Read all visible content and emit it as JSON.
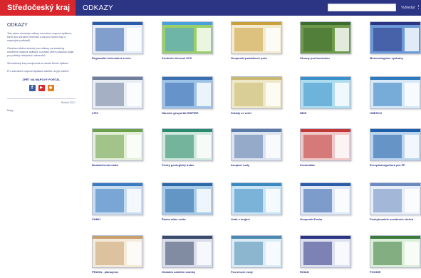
{
  "header": {
    "brand": "Středočeský kraj",
    "section": "ODKAZY",
    "search_placeholder": "",
    "search_button": "Vyhledat"
  },
  "sidebar": {
    "title": "ODKAZY",
    "intro": "Tato sekce obsahuje odkazy na externí mapové aplikace, které jsou zdrojem informací a dat pro tvorbu map a mapových podkladů.",
    "text2": "Obsahem těchto stránek jsou odkazy na tematicky zaměřené mapové aplikace a portály, které poskytují údaje pro potřeby veřejnosti i odborníků.",
    "text3": "Středočeský kraj neodpovídá za obsah těchto aplikací.",
    "text4": "Pro zobrazení mapové aplikace klikněte na její náhled.",
    "link": "ZPĚT NA MAPOVÝ PORTÁL",
    "date": "Ročník 2017",
    "footer": "Mapy"
  },
  "cards": [
    {
      "label": "Regionální informační servis",
      "theme": "#2b5ca8",
      "accent": "#e8eef8"
    },
    {
      "label": "Kontrolní činnost SVS",
      "theme": "#4aa0d8",
      "accent": "#9bcf6a"
    },
    {
      "label": "Geoportál památkové péče",
      "theme": "#c9a13a",
      "accent": "#f3ead0"
    },
    {
      "label": "Stromy pod kontrolou",
      "theme": "#3b6b2e",
      "accent": "#6f9a4a"
    },
    {
      "label": "Meteorologické výstrahy",
      "theme": "#2c3484",
      "accent": "#6c9ad8"
    },
    {
      "label": "LPIS",
      "theme": "#6e7e9a",
      "accent": "#e9eef5"
    },
    {
      "label": "Národní geoportál INSPIRE",
      "theme": "#3a6fb0",
      "accent": "#9cc2e8"
    },
    {
      "label": "Sráždy se zvěří",
      "theme": "#c8b870",
      "accent": "#efe8c8"
    },
    {
      "label": "NEIS",
      "theme": "#3a90c8",
      "accent": "#aeddf0"
    },
    {
      "label": "UNESCO",
      "theme": "#2b7ac0",
      "accent": "#d6e8f6"
    },
    {
      "label": "Bezbariérová místa",
      "theme": "#6ca04a",
      "accent": "#e4efda"
    },
    {
      "label": "Český geologický ústav",
      "theme": "#2a8a6a",
      "accent": "#cfe7dc"
    },
    {
      "label": "Koupací vody",
      "theme": "#5a7aa8",
      "accent": "#dbe4f0"
    },
    {
      "label": "Kriminalita",
      "theme": "#c03838",
      "accent": "#f0c8c8"
    },
    {
      "label": "Evropská agentura pro ŽP",
      "theme": "#1f5ea8",
      "accent": "#bcd4ee"
    },
    {
      "label": "ČHMÚ",
      "theme": "#3a7ac0",
      "accent": "#c8dcf0"
    },
    {
      "label": "Školní atlas světa",
      "theme": "#2a6aa8",
      "accent": "#a8cce8"
    },
    {
      "label": "Voda v krajině",
      "theme": "#3a8ac0",
      "accent": "#c8e4f4"
    },
    {
      "label": "Geoportál Praha",
      "theme": "#2b5ca8",
      "accent": "#dfe8f6"
    },
    {
      "label": "Poskytovatelé sociálních služeb",
      "theme": "#6a8ac0",
      "accent": "#e8eef8"
    },
    {
      "label": "PRAHA - plánujeme",
      "theme": "#c8a070",
      "accent": "#f4ead8"
    },
    {
      "label": "Globální satelitní snímky",
      "theme": "#3a4a6a",
      "accent": "#d8dce8"
    },
    {
      "label": "Povrchové vody",
      "theme": "#4a8ab0",
      "accent": "#dcecf6"
    },
    {
      "label": "RÚIAN",
      "theme": "#2c3484",
      "accent": "#dde1ef"
    },
    {
      "label": "FOODIE",
      "theme": "#3a7a3a",
      "accent": "#dbeed8"
    }
  ]
}
